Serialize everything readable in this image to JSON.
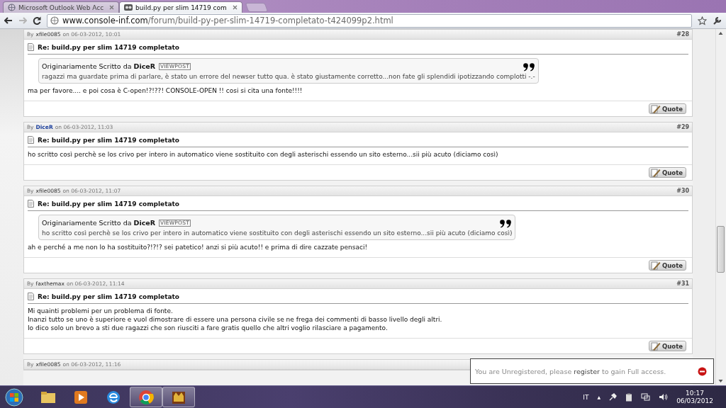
{
  "browser": {
    "tabs": [
      {
        "title": "Microsoft Outlook Web Acc",
        "selected": false,
        "kind": "globe"
      },
      {
        "title": "build.py per slim 14719 com",
        "selected": true,
        "kind": "site"
      }
    ],
    "url": {
      "domain": "www.console-inf.com",
      "path": "/forum/build-py-per-slim-14719-completato-t424099p2.html"
    }
  },
  "posts": [
    {
      "by": "By",
      "author": "xfile0085",
      "highlighted": false,
      "date": "on 06-03-2012, 10:01",
      "number": "#28",
      "title": "Re: build.py per slim 14719 completato",
      "quote": {
        "label": "Originariamente Scritto da",
        "author": "DiceR",
        "viewpost": "VIEWPOST",
        "body": "ragazzi ma guardate prima di parlare, è stato un errore del newser tutto qua. è stato giustamente corretto...non fate gli splendidi ipotizzando complotti -.-"
      },
      "message": [
        "ma per favore.... e poi cosa è C-open!?!??! CONSOLE-OPEN !! cosi si cita una fonte!!!!"
      ],
      "button": "Quote"
    },
    {
      "by": "By",
      "author": "DiceR",
      "highlighted": true,
      "date": "on 06-03-2012, 11:03",
      "number": "#29",
      "title": "Re: build.py per slim 14719 completato",
      "message": [
        "ho scritto così perchè se los crivo per intero in automatico viene sostituito con degli asterischi essendo un sito esterno...sii più acuto (diciamo così)"
      ],
      "button": "Quote"
    },
    {
      "by": "By",
      "author": "xfile0085",
      "highlighted": false,
      "date": "on 06-03-2012, 11:07",
      "number": "#30",
      "title": "Re: build.py per slim 14719 completato",
      "quote": {
        "label": "Originariamente Scritto da",
        "author": "DiceR",
        "viewpost": "VIEWPOST",
        "body": "ho scritto così perchè se los crivo per intero in automatico viene sostituito con degli asterischi essendo un sito esterno...sii più acuto (diciamo così)"
      },
      "message": [
        "ah e perché a me non lo ha sostituito?!?!? sei patetico! anzi si più acuto!! e prima di dire cazzate pensaci!"
      ],
      "button": "Quote"
    },
    {
      "by": "By",
      "author": "faxthemax",
      "highlighted": false,
      "date": "on 06-03-2012, 11:14",
      "number": "#31",
      "title": "Re: build.py per slim 14719 completato",
      "message": [
        "Mi quainti problemi per un problema di fonte.",
        "Inanzi tutto se uno è superiore e vuol dimostrare di essere una persona civile se ne frega dei commenti di basso livello degli altri.",
        "Io dico solo un brevo a sti due ragazzi che son riusciti a fare gratis quello che altri voglio rilasciare a pagamento."
      ],
      "button": "Quote"
    },
    {
      "by": "By",
      "author": "xfile0085",
      "highlighted": false,
      "date": "on 06-03-2012, 11:16"
    }
  ],
  "notice": {
    "before": "You are Unregistered, please",
    "link": "register",
    "after": "to gain Full access."
  },
  "taskbar": {
    "apps": [
      {
        "kind": "folder",
        "running": false
      },
      {
        "kind": "media",
        "running": false
      },
      {
        "kind": "ie",
        "running": false
      },
      {
        "kind": "chrome",
        "running": true
      },
      {
        "kind": "game",
        "running": true
      }
    ],
    "language": "IT",
    "tray_arrow": "▲",
    "time": "10:17",
    "date": "06/03/2012"
  }
}
